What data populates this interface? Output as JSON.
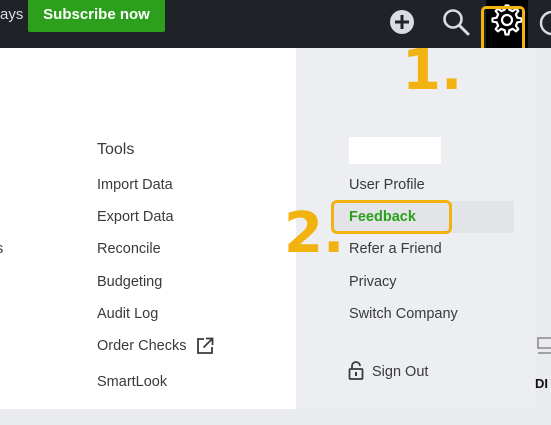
{
  "topbar": {
    "trial_text": "ays",
    "subscribe_label": "Subscribe now"
  },
  "annotations": {
    "step1": "1.",
    "step2": "2.",
    "accent_color": "#f2b20f"
  },
  "tools": {
    "title": "Tools",
    "items": [
      "Import Data",
      "Export Data",
      "Reconcile",
      "Budgeting",
      "Audit Log",
      "Order Checks",
      "SmartLook"
    ]
  },
  "left_cut": [
    "s"
  ],
  "profile": {
    "items": [
      "User Profile",
      "Feedback",
      "Refer a Friend",
      "Privacy",
      "Switch Company"
    ],
    "sign_out": "Sign Out"
  },
  "background_edge_text": "DI",
  "colors": {
    "brand_green": "#2ca01c",
    "topbar": "#1f2226"
  },
  "icons": [
    "plus-icon",
    "search-icon",
    "gear-icon",
    "help-icon",
    "external-link-icon",
    "lock-icon"
  ]
}
